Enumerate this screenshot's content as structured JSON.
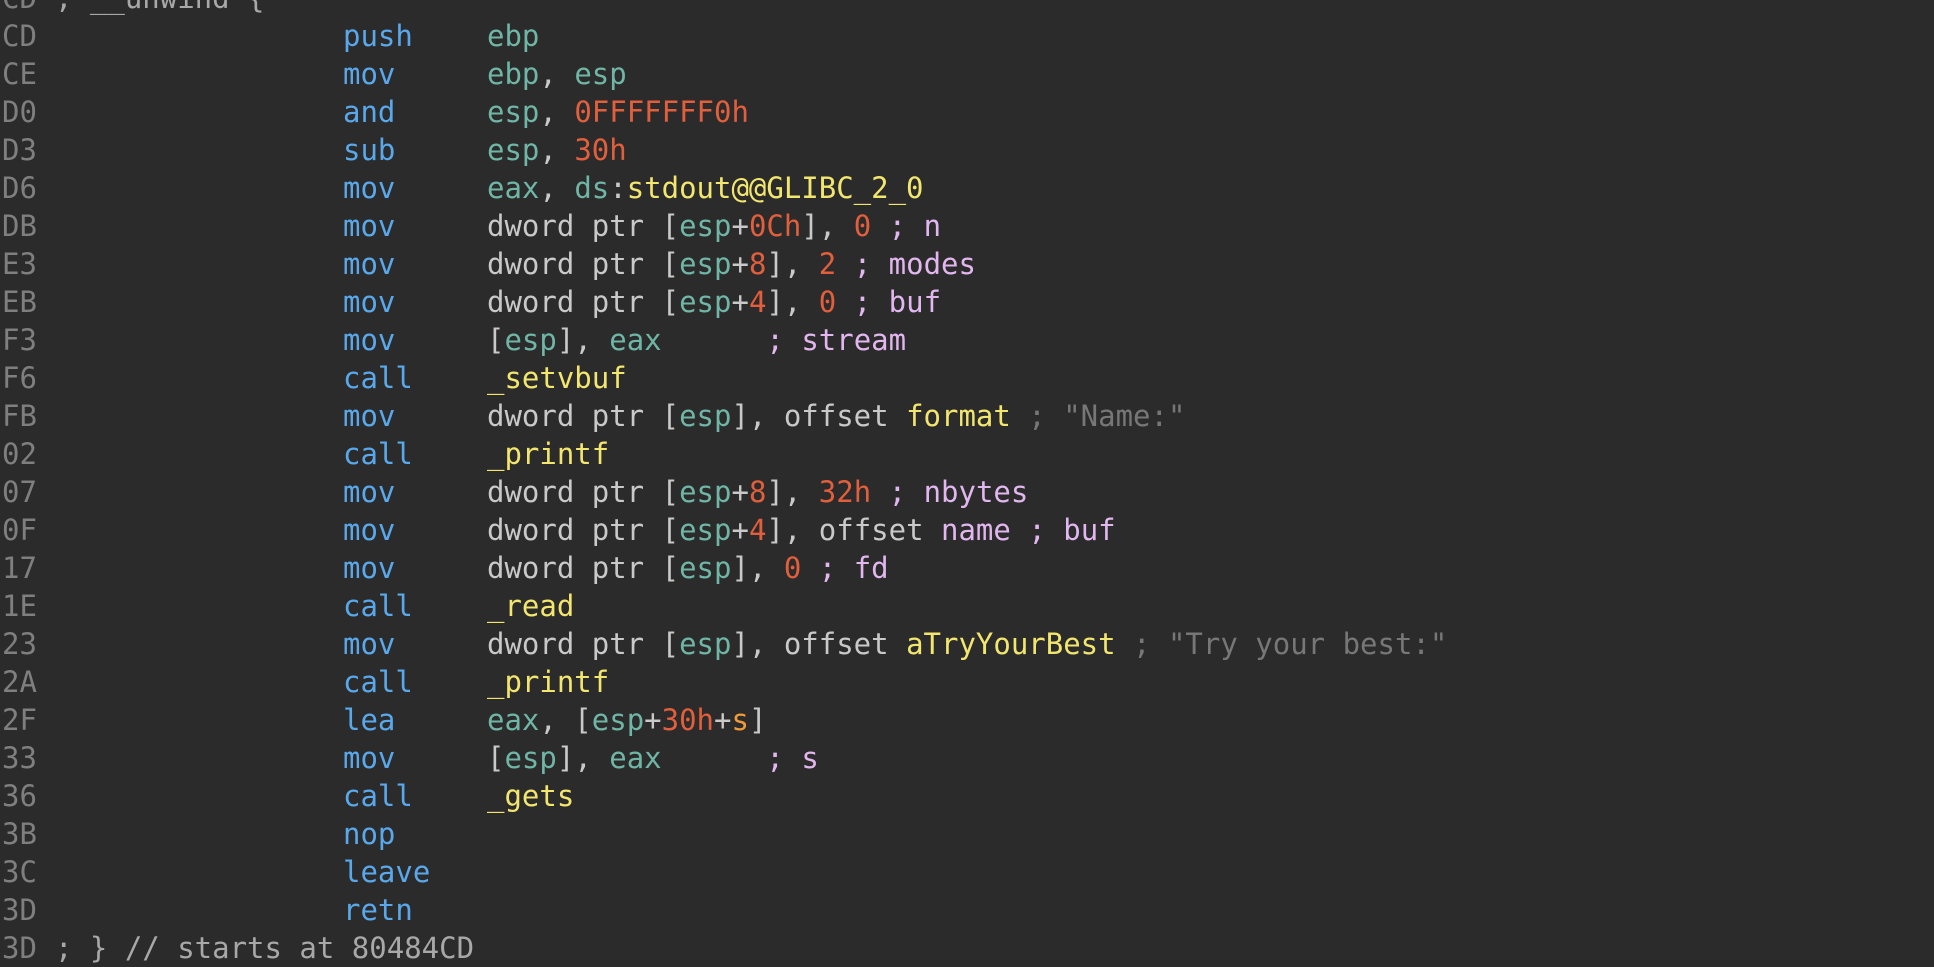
{
  "colors": {
    "background": "#2b2b2b",
    "address": "#7f7f7f",
    "mnemonic": "#59a8ec",
    "register": "#6fb6a6",
    "number": "#e15f3c",
    "symbol": "#f2e66e",
    "variable": "#e2b6ef",
    "comment": "#777777",
    "text": "#c9c9c9",
    "local": "#f19b3a"
  },
  "lines": [
    {
      "addr": "CD",
      "comment": "; __unwind {"
    },
    {
      "addr": "CD",
      "mnem": "push",
      "ops": [
        {
          "t": "ebp",
          "c": "reg"
        }
      ]
    },
    {
      "addr": "CE",
      "mnem": "mov",
      "ops": [
        {
          "t": "ebp",
          "c": "reg"
        },
        {
          "t": ", ",
          "c": "pun"
        },
        {
          "t": "esp",
          "c": "reg"
        }
      ]
    },
    {
      "addr": "D0",
      "mnem": "and",
      "ops": [
        {
          "t": "esp",
          "c": "reg"
        },
        {
          "t": ", ",
          "c": "pun"
        },
        {
          "t": "0FFFFFFF0h",
          "c": "num"
        }
      ]
    },
    {
      "addr": "D3",
      "mnem": "sub",
      "ops": [
        {
          "t": "esp",
          "c": "reg"
        },
        {
          "t": ", ",
          "c": "pun"
        },
        {
          "t": "30h",
          "c": "num"
        }
      ]
    },
    {
      "addr": "D6",
      "mnem": "mov",
      "ops": [
        {
          "t": "eax",
          "c": "reg"
        },
        {
          "t": ", ",
          "c": "pun"
        },
        {
          "t": "ds",
          "c": "reg"
        },
        {
          "t": ":",
          "c": "pun"
        },
        {
          "t": "stdout@@GLIBC_2_0",
          "c": "sym"
        }
      ]
    },
    {
      "addr": "DB",
      "mnem": "mov",
      "ops": [
        {
          "t": "dword ptr ",
          "c": "txt"
        },
        {
          "t": "[",
          "c": "pun"
        },
        {
          "t": "esp",
          "c": "reg"
        },
        {
          "t": "+",
          "c": "pun"
        },
        {
          "t": "0Ch",
          "c": "num"
        },
        {
          "t": "], ",
          "c": "pun"
        },
        {
          "t": "0",
          "c": "num"
        },
        {
          "t": " ; n",
          "c": "var"
        }
      ]
    },
    {
      "addr": "E3",
      "mnem": "mov",
      "ops": [
        {
          "t": "dword ptr ",
          "c": "txt"
        },
        {
          "t": "[",
          "c": "pun"
        },
        {
          "t": "esp",
          "c": "reg"
        },
        {
          "t": "+",
          "c": "pun"
        },
        {
          "t": "8",
          "c": "num"
        },
        {
          "t": "], ",
          "c": "pun"
        },
        {
          "t": "2",
          "c": "num"
        },
        {
          "t": " ; modes",
          "c": "var"
        }
      ]
    },
    {
      "addr": "EB",
      "mnem": "mov",
      "ops": [
        {
          "t": "dword ptr ",
          "c": "txt"
        },
        {
          "t": "[",
          "c": "pun"
        },
        {
          "t": "esp",
          "c": "reg"
        },
        {
          "t": "+",
          "c": "pun"
        },
        {
          "t": "4",
          "c": "num"
        },
        {
          "t": "], ",
          "c": "pun"
        },
        {
          "t": "0",
          "c": "num"
        },
        {
          "t": " ; buf",
          "c": "var"
        }
      ]
    },
    {
      "addr": "F3",
      "mnem": "mov",
      "ops": [
        {
          "t": "[",
          "c": "pun"
        },
        {
          "t": "esp",
          "c": "reg"
        },
        {
          "t": "], ",
          "c": "pun"
        },
        {
          "t": "eax",
          "c": "reg"
        },
        {
          "t": "      ; stream",
          "c": "var"
        }
      ]
    },
    {
      "addr": "F6",
      "mnem": "call",
      "ops": [
        {
          "t": "_setvbuf",
          "c": "sym"
        }
      ]
    },
    {
      "addr": "FB",
      "mnem": "mov",
      "ops": [
        {
          "t": "dword ptr ",
          "c": "txt"
        },
        {
          "t": "[",
          "c": "pun"
        },
        {
          "t": "esp",
          "c": "reg"
        },
        {
          "t": "], offset ",
          "c": "pun"
        },
        {
          "t": "format",
          "c": "sym"
        },
        {
          "t": " ; \"Name:\"",
          "c": "cmt"
        }
      ]
    },
    {
      "addr": "02",
      "mnem": "call",
      "ops": [
        {
          "t": "_printf",
          "c": "sym"
        }
      ]
    },
    {
      "addr": "07",
      "mnem": "mov",
      "ops": [
        {
          "t": "dword ptr ",
          "c": "txt"
        },
        {
          "t": "[",
          "c": "pun"
        },
        {
          "t": "esp",
          "c": "reg"
        },
        {
          "t": "+",
          "c": "pun"
        },
        {
          "t": "8",
          "c": "num"
        },
        {
          "t": "], ",
          "c": "pun"
        },
        {
          "t": "32h",
          "c": "num"
        },
        {
          "t": " ; nbytes",
          "c": "var"
        }
      ]
    },
    {
      "addr": "0F",
      "mnem": "mov",
      "ops": [
        {
          "t": "dword ptr ",
          "c": "txt"
        },
        {
          "t": "[",
          "c": "pun"
        },
        {
          "t": "esp",
          "c": "reg"
        },
        {
          "t": "+",
          "c": "pun"
        },
        {
          "t": "4",
          "c": "num"
        },
        {
          "t": "], offset ",
          "c": "pun"
        },
        {
          "t": "name ; buf",
          "c": "var"
        }
      ]
    },
    {
      "addr": "17",
      "mnem": "mov",
      "ops": [
        {
          "t": "dword ptr ",
          "c": "txt"
        },
        {
          "t": "[",
          "c": "pun"
        },
        {
          "t": "esp",
          "c": "reg"
        },
        {
          "t": "], ",
          "c": "pun"
        },
        {
          "t": "0",
          "c": "num"
        },
        {
          "t": " ; fd",
          "c": "var"
        }
      ]
    },
    {
      "addr": "1E",
      "mnem": "call",
      "ops": [
        {
          "t": "_read",
          "c": "sym"
        }
      ]
    },
    {
      "addr": "23",
      "mnem": "mov",
      "ops": [
        {
          "t": "dword ptr ",
          "c": "txt"
        },
        {
          "t": "[",
          "c": "pun"
        },
        {
          "t": "esp",
          "c": "reg"
        },
        {
          "t": "], offset ",
          "c": "pun"
        },
        {
          "t": "aTryYourBest",
          "c": "sym"
        },
        {
          "t": " ; \"Try your best:\"",
          "c": "cmt"
        }
      ]
    },
    {
      "addr": "2A",
      "mnem": "call",
      "ops": [
        {
          "t": "_printf",
          "c": "sym"
        }
      ]
    },
    {
      "addr": "2F",
      "mnem": "lea",
      "ops": [
        {
          "t": "eax",
          "c": "reg"
        },
        {
          "t": ", [",
          "c": "pun"
        },
        {
          "t": "esp",
          "c": "reg"
        },
        {
          "t": "+",
          "c": "pun"
        },
        {
          "t": "30h",
          "c": "num"
        },
        {
          "t": "+",
          "c": "pun"
        },
        {
          "t": "s",
          "c": "loc"
        },
        {
          "t": "]",
          "c": "pun"
        }
      ]
    },
    {
      "addr": "33",
      "mnem": "mov",
      "ops": [
        {
          "t": "[",
          "c": "pun"
        },
        {
          "t": "esp",
          "c": "reg"
        },
        {
          "t": "], ",
          "c": "pun"
        },
        {
          "t": "eax",
          "c": "reg"
        },
        {
          "t": "      ; s",
          "c": "var"
        }
      ]
    },
    {
      "addr": "36",
      "mnem": "call",
      "ops": [
        {
          "t": "_gets",
          "c": "sym"
        }
      ]
    },
    {
      "addr": "3B",
      "mnem": "nop",
      "ops": []
    },
    {
      "addr": "3C",
      "mnem": "leave",
      "ops": []
    },
    {
      "addr": "3D",
      "mnem": "retn",
      "ops": []
    },
    {
      "addr": "3D",
      "comment": "; } // starts at 80484CD"
    }
  ]
}
